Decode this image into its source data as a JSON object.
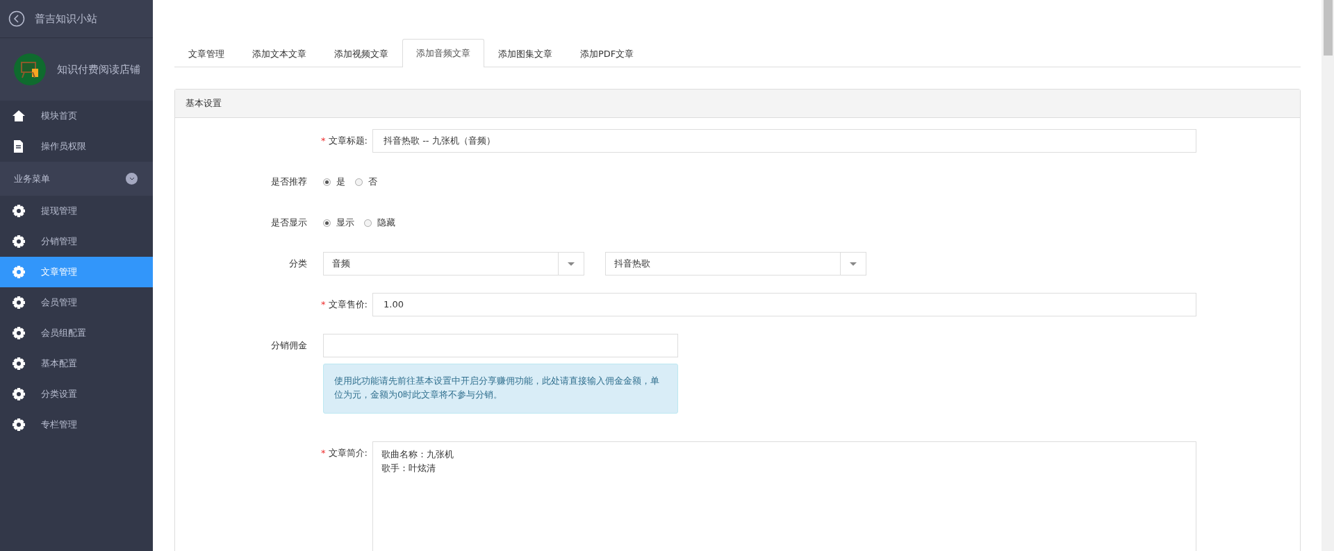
{
  "sidebar": {
    "title": "普吉知识小站",
    "shop_name": "知识付费阅读店铺",
    "items": [
      {
        "label": "模块首页",
        "kind": "home"
      },
      {
        "label": "操作员权限",
        "kind": "doc"
      }
    ],
    "section": {
      "label": "业务菜单"
    },
    "business_items": [
      {
        "label": "提现管理",
        "selected": false
      },
      {
        "label": "分销管理",
        "selected": false
      },
      {
        "label": "文章管理",
        "selected": true
      },
      {
        "label": "会员管理",
        "selected": false
      },
      {
        "label": "会员组配置",
        "selected": false
      },
      {
        "label": "基本配置",
        "selected": false
      },
      {
        "label": "分类设置",
        "selected": false
      },
      {
        "label": "专栏管理",
        "selected": false
      }
    ]
  },
  "tabs": [
    {
      "label": "文章管理",
      "selected": false
    },
    {
      "label": "添加文本文章",
      "selected": false
    },
    {
      "label": "添加视频文章",
      "selected": false
    },
    {
      "label": "添加音频文章",
      "selected": true
    },
    {
      "label": "添加图集文章",
      "selected": false
    },
    {
      "label": "添加PDF文章",
      "selected": false
    }
  ],
  "panel": {
    "title": "基本设置",
    "fields": [
      {
        "kind": "text",
        "required_mark": "*",
        "label": "文章标题:",
        "value": "抖音热歌 -- 九张机（音频）"
      },
      {
        "kind": "radio",
        "label": "是否推荐",
        "options": [
          {
            "label": "是",
            "selected": true
          },
          {
            "label": "否",
            "selected": false
          }
        ]
      },
      {
        "kind": "radio",
        "label": "是否显示",
        "options": [
          {
            "label": "显示",
            "selected": true
          },
          {
            "label": "隐藏",
            "selected": false
          }
        ]
      },
      {
        "kind": "select",
        "label": "分类",
        "selects": [
          {
            "value": "音频"
          },
          {
            "value": "抖音热歌"
          }
        ]
      },
      {
        "kind": "text",
        "required_mark": "*",
        "label": "文章售价:",
        "value": "1.00"
      },
      {
        "kind": "note_input",
        "label": "分销佣金",
        "note": "使用此功能请先前往基本设置中开启分享赚佣功能，此处请直接输入佣金金额，单位为元，金额为0时此文章将不参与分销。"
      },
      {
        "kind": "textarea",
        "required_mark": "*",
        "label": "文章简介:",
        "lines": [
          "歌曲名称：九张机",
          "歌手：叶炫清"
        ]
      }
    ]
  }
}
